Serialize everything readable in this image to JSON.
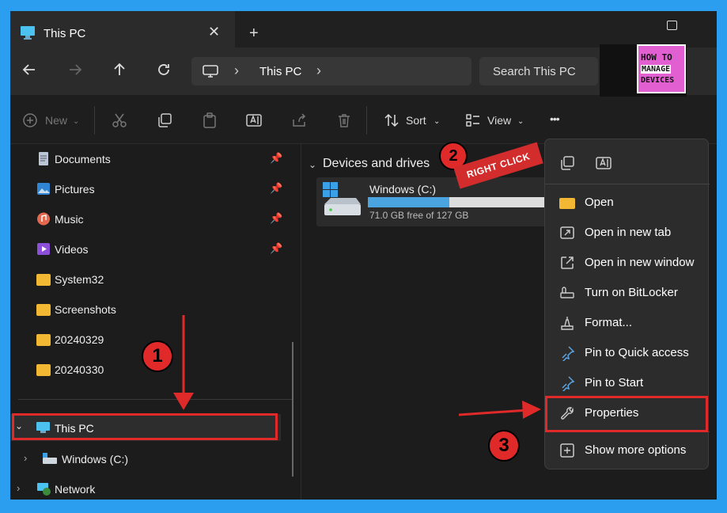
{
  "window": {
    "tab_title": "This PC",
    "tab_close": "✕",
    "new_tab": "+"
  },
  "address": {
    "breadcrumb": "This PC",
    "chevron": "›",
    "search_placeholder": "Search This PC"
  },
  "logo": {
    "line1": "HOW TO",
    "line2": "MANAGE",
    "line3": "DEVICES"
  },
  "toolbar": {
    "new_label": "New",
    "sort_label": "Sort",
    "view_label": "View",
    "more_label": "•••"
  },
  "sidebar": {
    "items": [
      {
        "label": "Documents",
        "icon": "document-icon",
        "pinned": true
      },
      {
        "label": "Pictures",
        "icon": "pictures-icon",
        "pinned": true
      },
      {
        "label": "Music",
        "icon": "music-icon",
        "pinned": true
      },
      {
        "label": "Videos",
        "icon": "videos-icon",
        "pinned": true
      },
      {
        "label": "System32",
        "icon": "folder-icon",
        "pinned": false
      },
      {
        "label": "Screenshots",
        "icon": "folder-icon",
        "pinned": false
      },
      {
        "label": "20240329",
        "icon": "folder-icon",
        "pinned": false
      },
      {
        "label": "20240330",
        "icon": "folder-icon",
        "pinned": false
      }
    ],
    "this_pc": "This PC",
    "windows_c": "Windows (C:)",
    "network": "Network"
  },
  "main": {
    "section_title": "Devices and drives",
    "drive": {
      "name": "Windows (C:)",
      "free_text": "71.0 GB free of 127 GB",
      "used_fraction": 0.44
    }
  },
  "context_menu": {
    "items": [
      {
        "label": "Open",
        "icon": "folder-open-icon"
      },
      {
        "label": "Open in new tab",
        "icon": "new-tab-icon"
      },
      {
        "label": "Open in new window",
        "icon": "new-window-icon"
      },
      {
        "label": "Turn on BitLocker",
        "icon": "bitlocker-icon"
      },
      {
        "label": "Format...",
        "icon": "format-icon"
      },
      {
        "label": "Pin to Quick access",
        "icon": "pin-icon"
      },
      {
        "label": "Pin to Start",
        "icon": "pin-icon"
      },
      {
        "label": "Properties",
        "icon": "wrench-icon"
      },
      {
        "label": "Show more options",
        "icon": "more-options-icon"
      }
    ]
  },
  "annotations": {
    "step1": "1",
    "step2": "2",
    "step3": "3",
    "right_click": "RIGHT CLICK"
  },
  "colors": {
    "background_frame": "#2b9ef0",
    "highlight_red": "#e02a2a",
    "drive_bar": "#4aa4e0",
    "folder": "#f2b733"
  }
}
